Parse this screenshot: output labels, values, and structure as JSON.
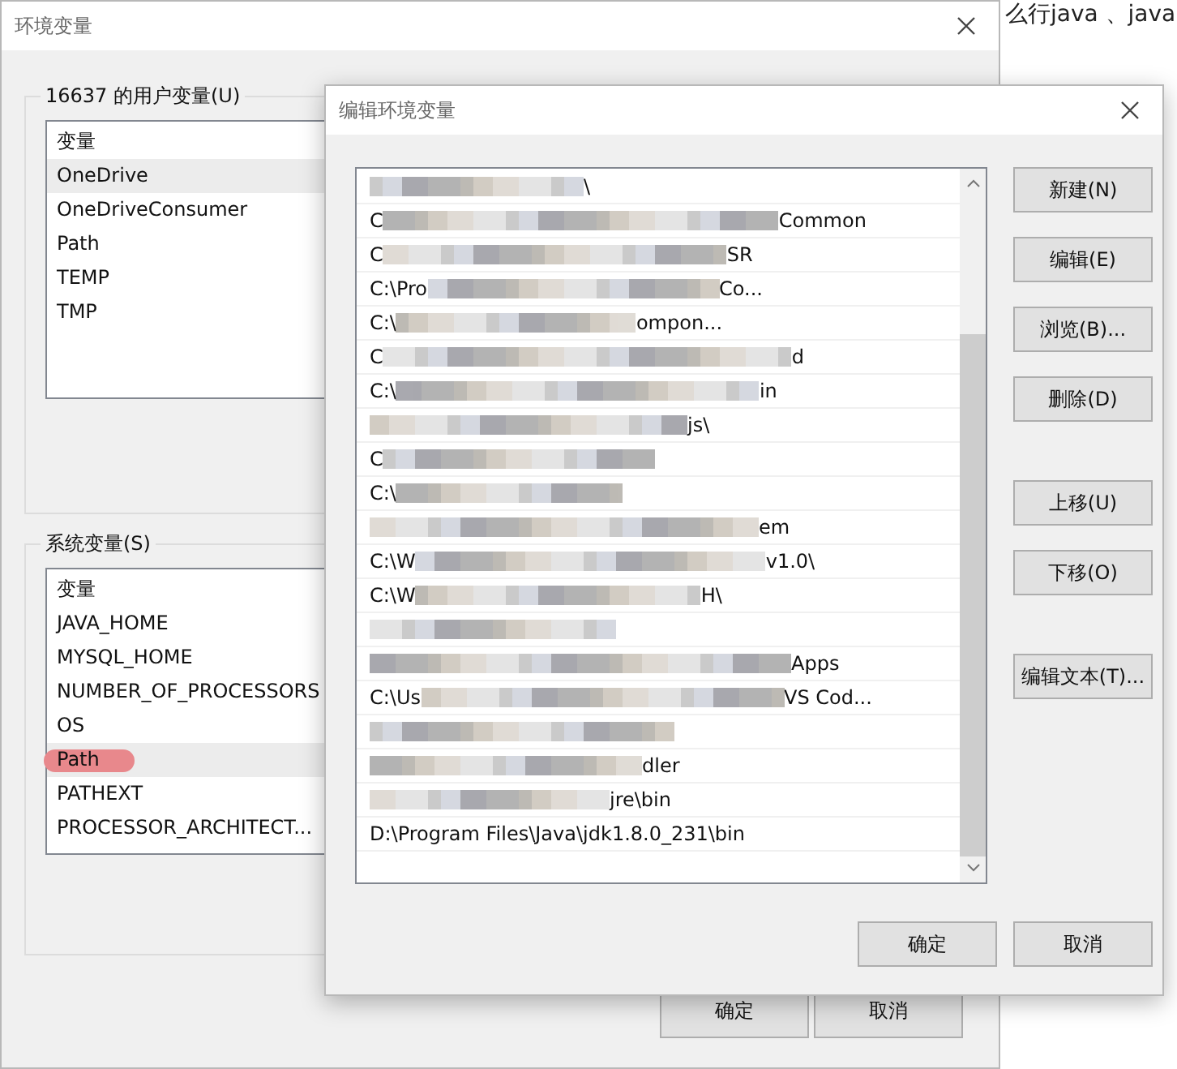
{
  "background_text": "么行java 、java",
  "env_window": {
    "title": "环境变量",
    "user_group": {
      "title": "16637 的用户变量(U)",
      "column": "变量",
      "items": [
        {
          "name": "OneDrive",
          "selected": true,
          "marked": false
        },
        {
          "name": "OneDriveConsumer",
          "selected": false,
          "marked": false
        },
        {
          "name": "Path",
          "selected": false,
          "marked": false
        },
        {
          "name": "TEMP",
          "selected": false,
          "marked": false
        },
        {
          "name": "TMP",
          "selected": false,
          "marked": false
        }
      ]
    },
    "system_group": {
      "title": "系统变量(S)",
      "column": "变量",
      "items": [
        {
          "name": "JAVA_HOME",
          "selected": false,
          "marked": false
        },
        {
          "name": "MYSQL_HOME",
          "selected": false,
          "marked": false
        },
        {
          "name": "NUMBER_OF_PROCESSORS",
          "selected": false,
          "marked": false
        },
        {
          "name": "OS",
          "selected": false,
          "marked": false
        },
        {
          "name": "Path",
          "selected": true,
          "marked": true
        },
        {
          "name": "PATHEXT",
          "selected": false,
          "marked": false
        },
        {
          "name": "PROCESSOR_ARCHITECT...",
          "selected": false,
          "marked": false
        }
      ]
    },
    "buttons": [
      "确定",
      "取消"
    ]
  },
  "edit_window": {
    "title": "编辑环境变量",
    "entries": [
      {
        "kind": "blurred",
        "suffix": "\\"
      },
      {
        "kind": "blurred",
        "prefix": "C",
        "suffix": "Common"
      },
      {
        "kind": "blurred",
        "prefix": "C",
        "suffix": "SR"
      },
      {
        "kind": "blurred",
        "prefix": "C:\\Pro",
        "suffix": "Co..."
      },
      {
        "kind": "blurred",
        "prefix": "C:\\",
        "suffix": "ompon..."
      },
      {
        "kind": "blurred",
        "prefix": "C",
        "suffix": "d"
      },
      {
        "kind": "blurred",
        "prefix": "C:\\",
        "suffix": "in"
      },
      {
        "kind": "blurred",
        "suffix": "js\\"
      },
      {
        "kind": "blurred",
        "prefix": "C"
      },
      {
        "kind": "blurred",
        "prefix": "C:\\"
      },
      {
        "kind": "blurred",
        "suffix": "em"
      },
      {
        "kind": "blurred",
        "prefix": "C:\\W",
        "suffix": "v1.0\\"
      },
      {
        "kind": "blurred",
        "prefix": "C:\\W",
        "suffix": "H\\"
      },
      {
        "kind": "blurred"
      },
      {
        "kind": "blurred",
        "suffix": "Apps"
      },
      {
        "kind": "blurred",
        "prefix": "C:\\Us",
        "suffix": "VS Cod..."
      },
      {
        "kind": "blurred"
      },
      {
        "kind": "blurred",
        "suffix": "dler"
      },
      {
        "kind": "blurred",
        "suffix": "jre\\bin"
      },
      {
        "kind": "plain",
        "text": "D:\\Program Files\\Java\\jdk1.8.0_231\\bin"
      }
    ],
    "side_button_groups": [
      [
        "新建(N)",
        "编辑(E)",
        "浏览(B)...",
        "删除(D)"
      ],
      [
        "上移(U)",
        "下移(O)"
      ],
      [
        "编辑文本(T)..."
      ]
    ],
    "buttons": [
      "确定",
      "取消"
    ]
  }
}
